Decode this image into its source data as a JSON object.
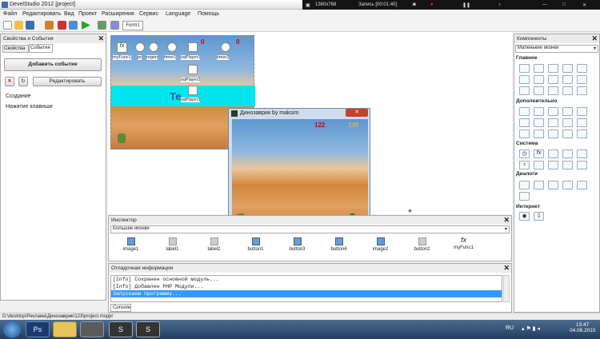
{
  "window": {
    "title": "DevelStudio 2012 [project]"
  },
  "recorder": {
    "resolution": "1360x768",
    "status": "Запись [00:01:40]"
  },
  "menu": [
    "Файл",
    "Редактировать",
    "Вид",
    "Проект",
    "Расширения",
    "Сервис",
    "Language",
    "Помощь"
  ],
  "form_tab": "Form1",
  "props_panel": {
    "title": "Свойства и События",
    "tabs": [
      "Свойства",
      "События"
    ],
    "add_event": "Добавить событие",
    "edit": "Редактировать",
    "events": [
      "Создание",
      "Нажатие клавиши"
    ]
  },
  "form_objects": [
    "myFunc1",
    "pr",
    "regen",
    "timer1",
    "sqPlayer1",
    "timer2",
    "sqPlayer2",
    "sqPlayer3"
  ],
  "form_text": "Те",
  "form_numbers": [
    "0",
    "0"
  ],
  "game_window": {
    "title": "Динозаврик by maksim",
    "score1": "122",
    "score2": "149"
  },
  "inspector": {
    "title": "Инспектор",
    "view": "Большие иконки",
    "items": [
      "image1",
      "label1",
      "label2",
      "button1",
      "button3",
      "button4",
      "image2",
      "button2",
      "myFunc1"
    ]
  },
  "debug": {
    "title": "Отладочная информация",
    "lines": [
      "[Info] Сохранен основной модуль...",
      "[Info] Добавлен PHP Модули...",
      "Запускаем программу..."
    ],
    "tab": "Console"
  },
  "components": {
    "title": "Компоненты",
    "view": "Маленькие иконки",
    "sections": [
      "Главное",
      "Дополнительно",
      "Система",
      "Диалоги",
      "Интернет"
    ]
  },
  "status_path": "D:\\desktop\\Реклама\\Динозаврик\\123\\project.msppr",
  "tray": {
    "lang": "RU",
    "time": "13:47",
    "date": "04.08.2015"
  },
  "colors": {
    "accent": "#3399ff",
    "cyan": "#00e5ee"
  }
}
